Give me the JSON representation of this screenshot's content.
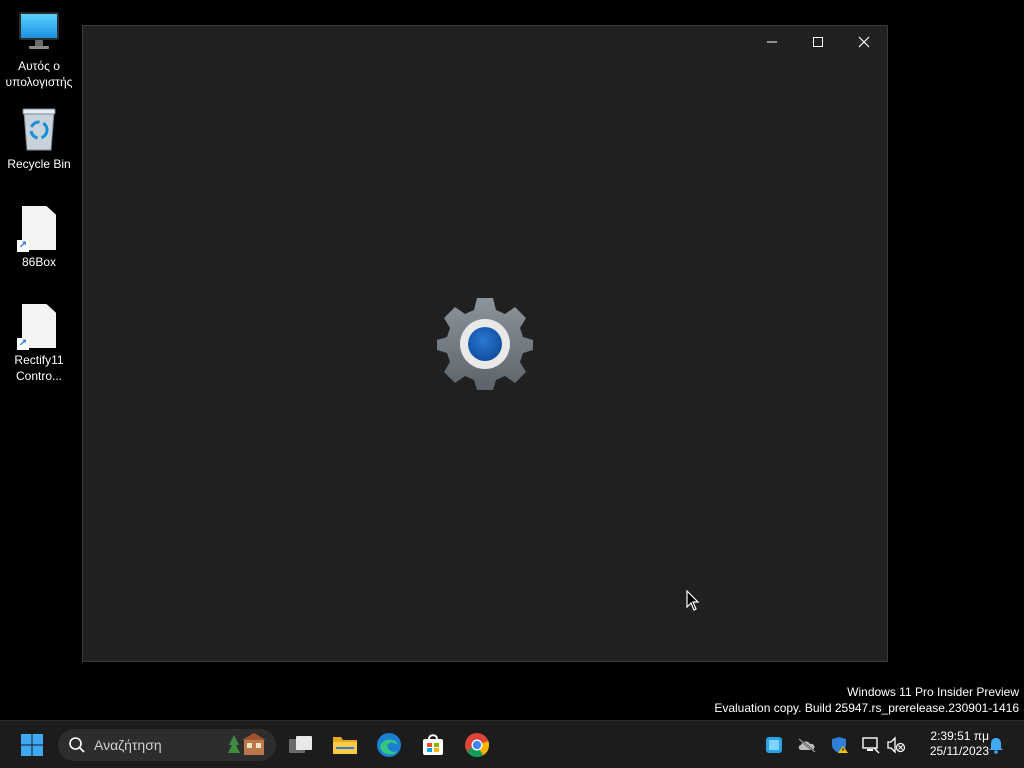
{
  "desktop": {
    "icons": [
      {
        "label": "Αυτός ο υπολογιστής",
        "icon": "monitor-icon"
      },
      {
        "label": "Recycle Bin",
        "icon": "recycle-bin-icon"
      },
      {
        "label": "86Box",
        "icon": "file-shortcut-icon"
      },
      {
        "label": "Rectify11 Contro...",
        "icon": "file-shortcut-icon"
      }
    ]
  },
  "settings_window": {
    "state": "loading splash",
    "accent": "#1a5fb4",
    "background": "#202020",
    "controls": [
      "minimize-icon",
      "maximize-icon",
      "close-icon"
    ]
  },
  "watermark": {
    "line1": "Windows 11 Pro Insider Preview",
    "line2": "Evaluation copy. Build 25947.rs_prerelease.230901-1416"
  },
  "taskbar": {
    "search_placeholder": "Αναζήτηση",
    "pinned": [
      "start-icon",
      "task-view-icon",
      "file-explorer-icon",
      "edge-icon",
      "store-icon",
      "chrome-icon"
    ],
    "tray": [
      "widgets-icon",
      "onedrive-icon",
      "security-icon",
      "network-icon",
      "volume-muted-icon"
    ],
    "clock": {
      "time": "2:39:51 πμ",
      "date": "25/11/2023"
    },
    "notification_icon": "bell-icon"
  }
}
